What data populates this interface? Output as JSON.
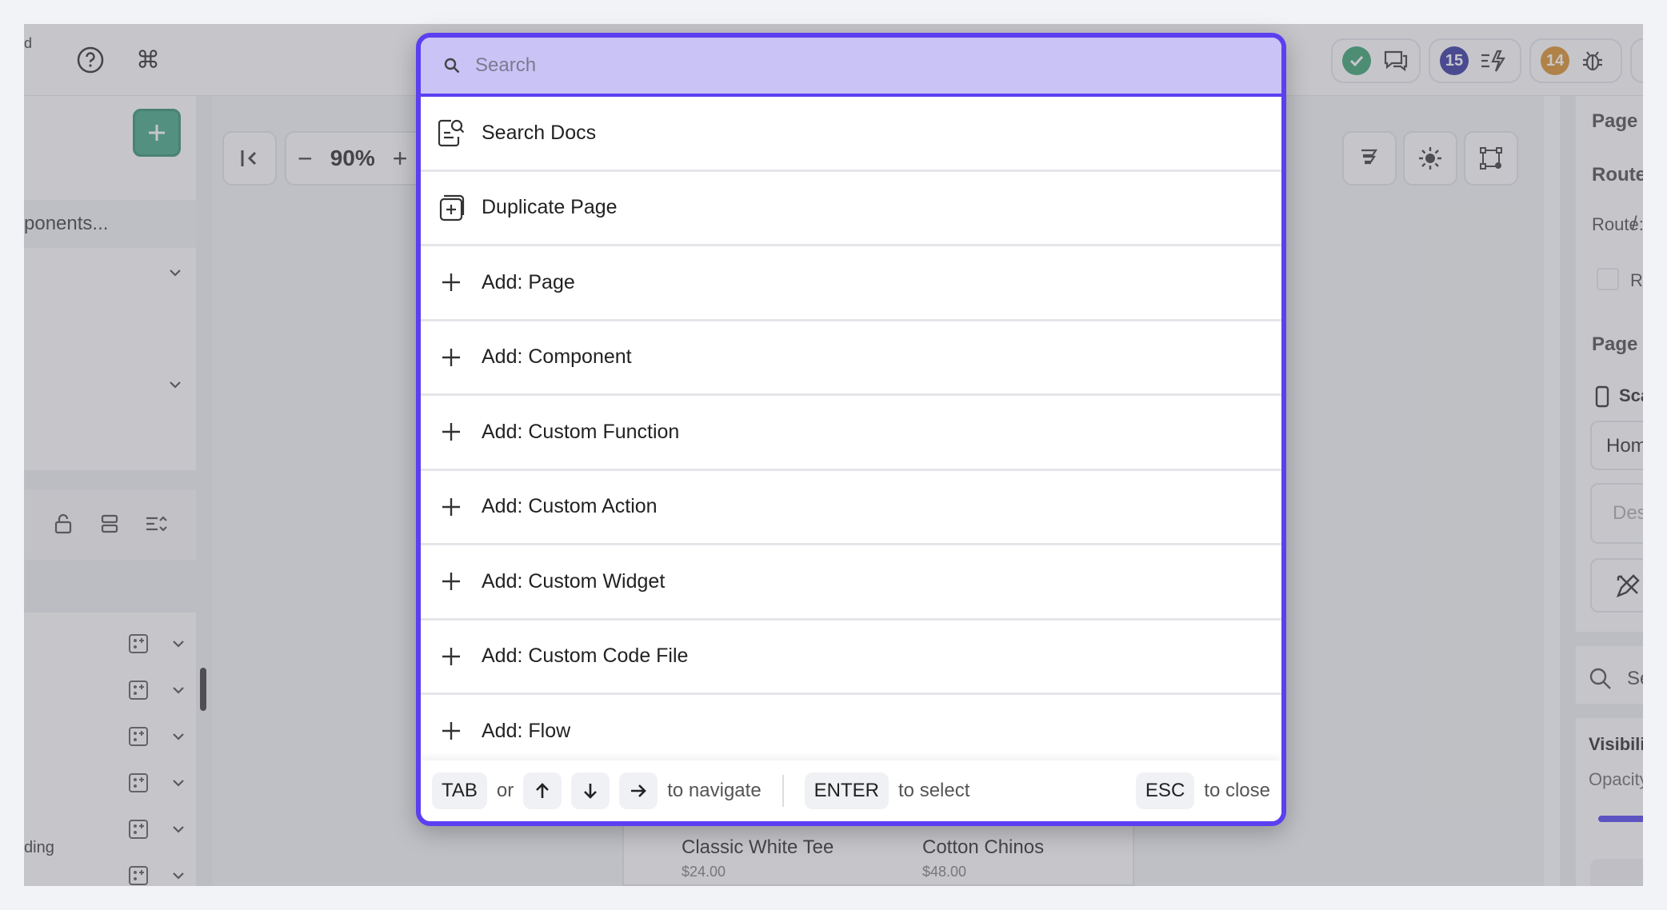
{
  "topbar": {
    "left_fragment": "d",
    "badges": {
      "green_count": "",
      "blue_count": "15",
      "orange_count": "14"
    }
  },
  "left_panel": {
    "search_text": "ponents...",
    "bottom_row_label": "ding"
  },
  "canvas": {
    "zoom": "90%",
    "products": [
      {
        "name": "Classic White Tee",
        "price": "$24.00"
      },
      {
        "name": "Cotton Chinos",
        "price": "$48.00"
      }
    ]
  },
  "right_panel": {
    "page_params": "Page Par",
    "route_section": "Route Se",
    "route_label": "Route:",
    "route_value": "/",
    "required": "Requ",
    "page_imports": "Page Imp",
    "scaffold": "Scaffo",
    "name_value": "Home",
    "description_placeholder": "Descri",
    "search": "Sear",
    "visibility": "Visibility",
    "opacity": "Opacity"
  },
  "palette": {
    "search_placeholder": "Search",
    "items": [
      {
        "label": "Search Docs",
        "icon": "search-docs-icon"
      },
      {
        "label": "Duplicate Page",
        "icon": "duplicate-page-icon"
      },
      {
        "label": "Add: Page",
        "icon": "plus-icon"
      },
      {
        "label": "Add: Component",
        "icon": "plus-icon"
      },
      {
        "label": "Add: Custom Function",
        "icon": "plus-icon"
      },
      {
        "label": "Add: Custom Action",
        "icon": "plus-icon"
      },
      {
        "label": "Add: Custom Widget",
        "icon": "plus-icon"
      },
      {
        "label": "Add: Custom Code File",
        "icon": "plus-icon"
      },
      {
        "label": "Add: Flow",
        "icon": "plus-icon"
      }
    ],
    "footer": {
      "tab_key": "TAB",
      "or_text": "or",
      "navigate_text": "to navigate",
      "enter_key": "ENTER",
      "select_text": "to select",
      "esc_key": "ESC",
      "close_text": "to close"
    }
  },
  "colors": {
    "accent": "#5b3ff0",
    "search_bg": "#c9c3f6",
    "add_button": "#3aa37e",
    "badge_blue": "#2a2a9e",
    "badge_orange": "#d98a1f",
    "badge_green": "#2e9e6a"
  }
}
